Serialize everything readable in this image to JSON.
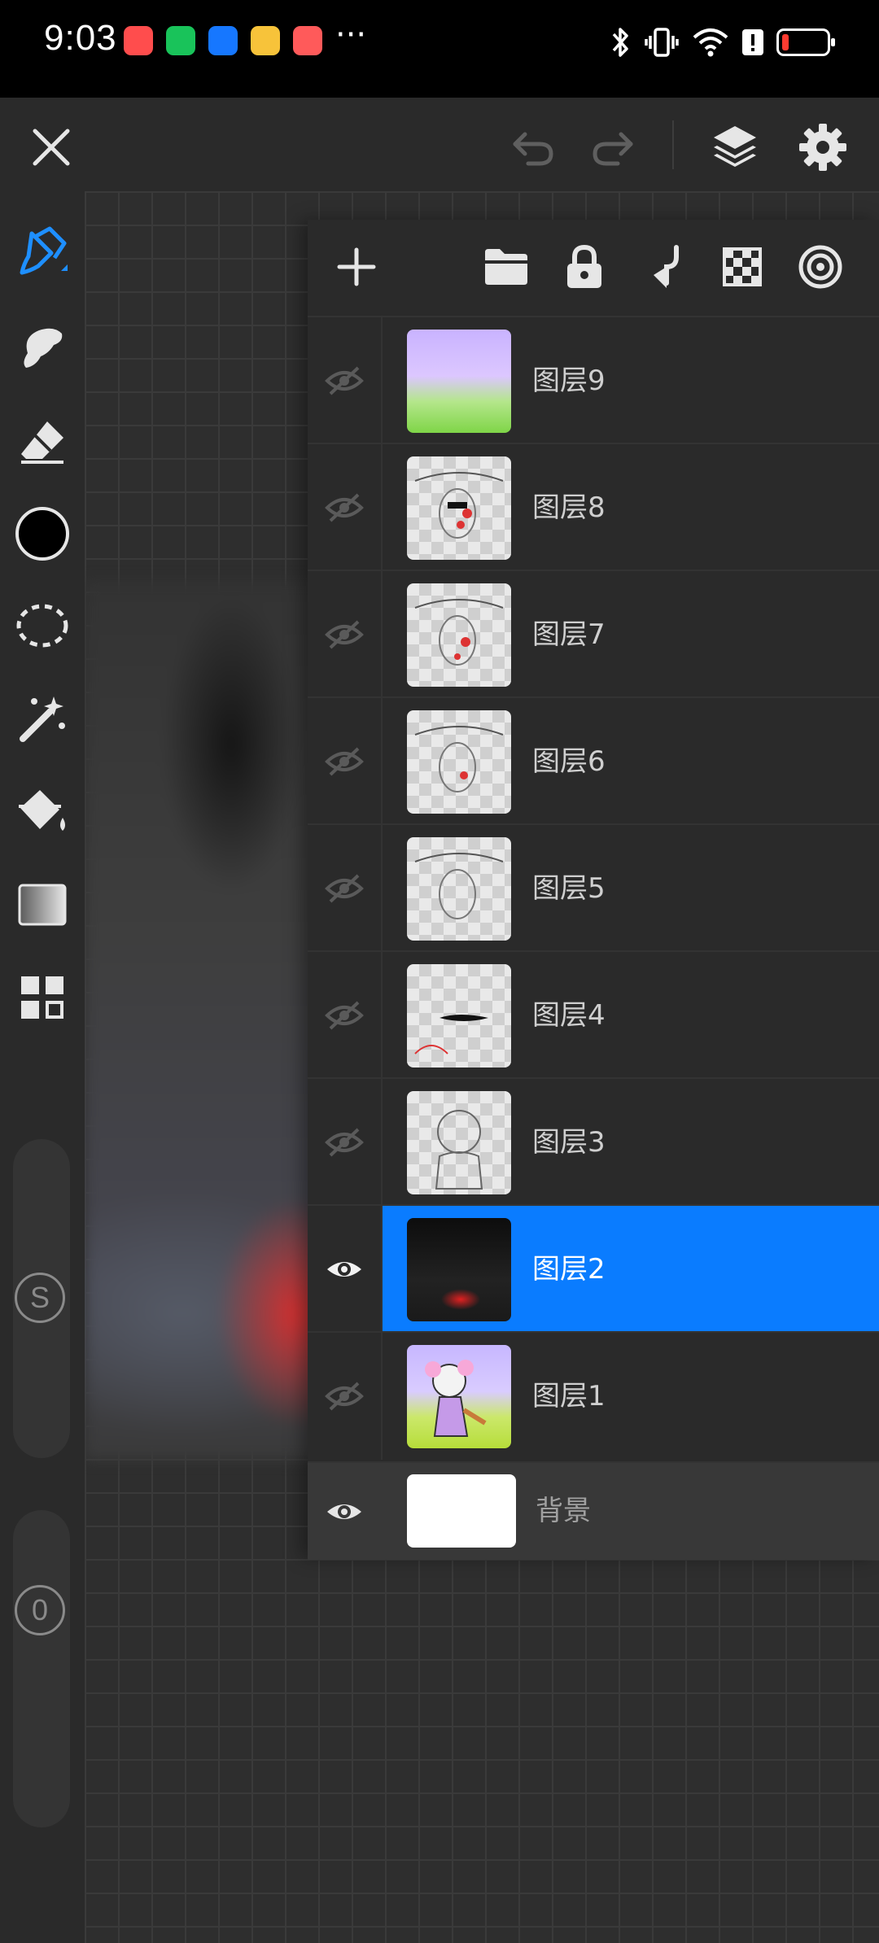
{
  "status_bar": {
    "time": "9:03",
    "notification_icons": [
      "app-red-icon",
      "wechat-icon",
      "alipay-icon",
      "game-app-icon",
      "app-red2-icon"
    ],
    "more": "···",
    "indicators": [
      "bluetooth-icon",
      "vibrate-icon",
      "wifi-icon",
      "alert-icon",
      "battery-icon"
    ],
    "battery_level": 0.1
  },
  "toolbar": {
    "close_icon": "close-icon",
    "undo_icon": "undo-icon",
    "redo_icon": "redo-icon",
    "layers_icon": "layers-icon",
    "settings_icon": "settings-icon"
  },
  "tools": [
    "brush-icon",
    "smudge-icon",
    "eraser-icon",
    "color-swatch",
    "lasso-icon",
    "magic-wand-icon",
    "fill-bucket-icon",
    "gradient-icon",
    "grid-more-icon"
  ],
  "size_slider": {
    "label": "S"
  },
  "opacity_slider": {
    "label": "0"
  },
  "accent_color": "#0a7cff",
  "layer_panel": {
    "actions": [
      "add-layer-icon",
      "folder-icon",
      "lock-icon",
      "merge-down-icon",
      "alpha-lock-icon",
      "clipping-icon"
    ],
    "layers": [
      {
        "name": "图层9",
        "visible": false,
        "selected": false
      },
      {
        "name": "图层8",
        "visible": false,
        "selected": false
      },
      {
        "name": "图层7",
        "visible": false,
        "selected": false
      },
      {
        "name": "图层6",
        "visible": false,
        "selected": false
      },
      {
        "name": "图层5",
        "visible": false,
        "selected": false
      },
      {
        "name": "图层4",
        "visible": false,
        "selected": false
      },
      {
        "name": "图层3",
        "visible": false,
        "selected": false
      },
      {
        "name": "图层2",
        "visible": true,
        "selected": true
      },
      {
        "name": "图层1",
        "visible": false,
        "selected": false
      }
    ],
    "background": {
      "name": "背景",
      "visible": true
    }
  }
}
